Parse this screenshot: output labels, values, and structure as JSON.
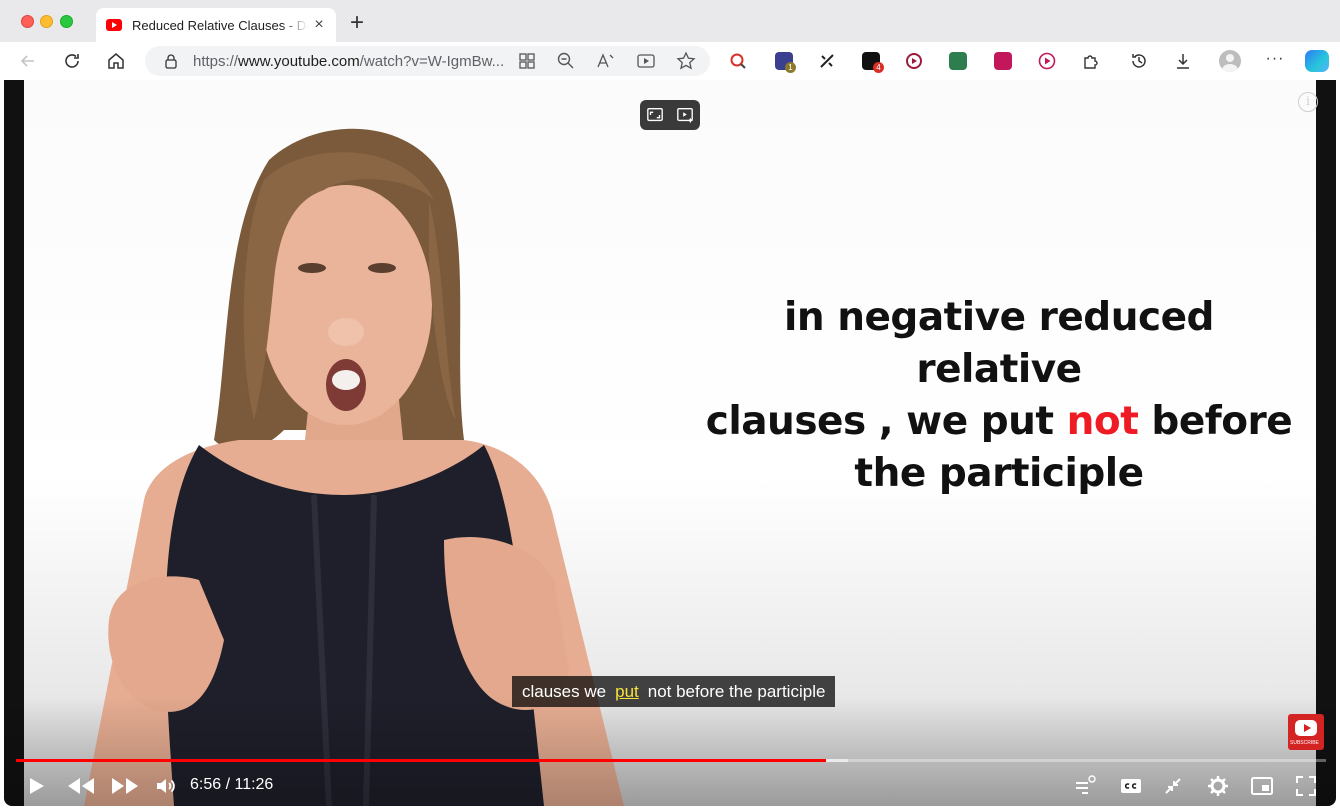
{
  "browser": {
    "tab_title": "Reduced Relative Clauses - Defining",
    "tab_close": "×",
    "new_tab": "+",
    "url_prefix": "https://",
    "url_host": "www.youtube.com",
    "url_path": "/watch?v=W-IgmBw...",
    "extension_badges": {
      "ext2": "1",
      "ext4": "4"
    },
    "more": "···"
  },
  "video": {
    "slide_line1": "in negative reduced relative",
    "slide_line2_a": "clauses , we put ",
    "slide_line2_red": "not",
    "slide_line2_b": " before",
    "slide_line3": "the participle",
    "caption_before": "clauses we",
    "caption_highlight": "put",
    "caption_after": "not before the participle",
    "subscribe_watermark": "SUBSCRIBE",
    "info": "i",
    "progress_played_fraction": 0.618,
    "progress_buffered_fraction": 0.635,
    "current_time": "6:56",
    "duration": "11:26",
    "time_display": "6:56 / 11:26"
  },
  "colors": {
    "accent_red": "#ff0000",
    "slide_red": "#ee1b24",
    "caption_highlight": "#f5e33a"
  }
}
